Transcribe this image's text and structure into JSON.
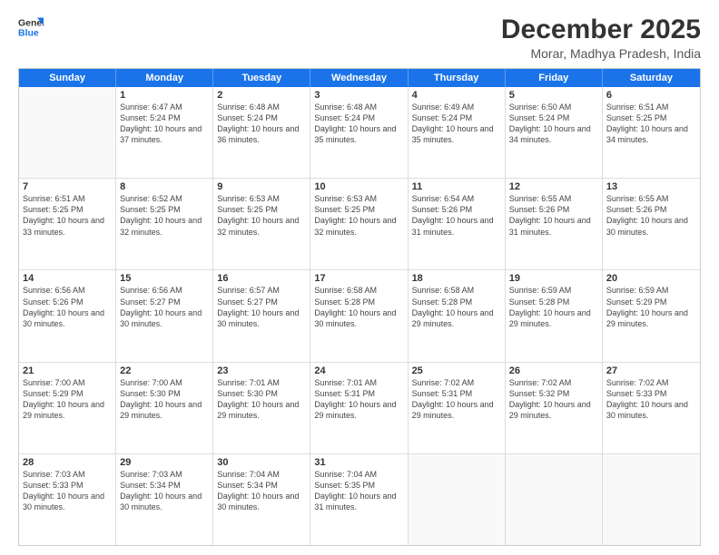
{
  "header": {
    "logo_line1": "General",
    "logo_line2": "Blue",
    "title": "December 2025",
    "subtitle": "Morar, Madhya Pradesh, India"
  },
  "weekdays": [
    "Sunday",
    "Monday",
    "Tuesday",
    "Wednesday",
    "Thursday",
    "Friday",
    "Saturday"
  ],
  "rows": [
    [
      {
        "day": "",
        "sunrise": "",
        "sunset": "",
        "daylight": ""
      },
      {
        "day": "1",
        "sunrise": "Sunrise: 6:47 AM",
        "sunset": "Sunset: 5:24 PM",
        "daylight": "Daylight: 10 hours and 37 minutes."
      },
      {
        "day": "2",
        "sunrise": "Sunrise: 6:48 AM",
        "sunset": "Sunset: 5:24 PM",
        "daylight": "Daylight: 10 hours and 36 minutes."
      },
      {
        "day": "3",
        "sunrise": "Sunrise: 6:48 AM",
        "sunset": "Sunset: 5:24 PM",
        "daylight": "Daylight: 10 hours and 35 minutes."
      },
      {
        "day": "4",
        "sunrise": "Sunrise: 6:49 AM",
        "sunset": "Sunset: 5:24 PM",
        "daylight": "Daylight: 10 hours and 35 minutes."
      },
      {
        "day": "5",
        "sunrise": "Sunrise: 6:50 AM",
        "sunset": "Sunset: 5:24 PM",
        "daylight": "Daylight: 10 hours and 34 minutes."
      },
      {
        "day": "6",
        "sunrise": "Sunrise: 6:51 AM",
        "sunset": "Sunset: 5:25 PM",
        "daylight": "Daylight: 10 hours and 34 minutes."
      }
    ],
    [
      {
        "day": "7",
        "sunrise": "Sunrise: 6:51 AM",
        "sunset": "Sunset: 5:25 PM",
        "daylight": "Daylight: 10 hours and 33 minutes."
      },
      {
        "day": "8",
        "sunrise": "Sunrise: 6:52 AM",
        "sunset": "Sunset: 5:25 PM",
        "daylight": "Daylight: 10 hours and 32 minutes."
      },
      {
        "day": "9",
        "sunrise": "Sunrise: 6:53 AM",
        "sunset": "Sunset: 5:25 PM",
        "daylight": "Daylight: 10 hours and 32 minutes."
      },
      {
        "day": "10",
        "sunrise": "Sunrise: 6:53 AM",
        "sunset": "Sunset: 5:25 PM",
        "daylight": "Daylight: 10 hours and 32 minutes."
      },
      {
        "day": "11",
        "sunrise": "Sunrise: 6:54 AM",
        "sunset": "Sunset: 5:26 PM",
        "daylight": "Daylight: 10 hours and 31 minutes."
      },
      {
        "day": "12",
        "sunrise": "Sunrise: 6:55 AM",
        "sunset": "Sunset: 5:26 PM",
        "daylight": "Daylight: 10 hours and 31 minutes."
      },
      {
        "day": "13",
        "sunrise": "Sunrise: 6:55 AM",
        "sunset": "Sunset: 5:26 PM",
        "daylight": "Daylight: 10 hours and 30 minutes."
      }
    ],
    [
      {
        "day": "14",
        "sunrise": "Sunrise: 6:56 AM",
        "sunset": "Sunset: 5:26 PM",
        "daylight": "Daylight: 10 hours and 30 minutes."
      },
      {
        "day": "15",
        "sunrise": "Sunrise: 6:56 AM",
        "sunset": "Sunset: 5:27 PM",
        "daylight": "Daylight: 10 hours and 30 minutes."
      },
      {
        "day": "16",
        "sunrise": "Sunrise: 6:57 AM",
        "sunset": "Sunset: 5:27 PM",
        "daylight": "Daylight: 10 hours and 30 minutes."
      },
      {
        "day": "17",
        "sunrise": "Sunrise: 6:58 AM",
        "sunset": "Sunset: 5:28 PM",
        "daylight": "Daylight: 10 hours and 30 minutes."
      },
      {
        "day": "18",
        "sunrise": "Sunrise: 6:58 AM",
        "sunset": "Sunset: 5:28 PM",
        "daylight": "Daylight: 10 hours and 29 minutes."
      },
      {
        "day": "19",
        "sunrise": "Sunrise: 6:59 AM",
        "sunset": "Sunset: 5:28 PM",
        "daylight": "Daylight: 10 hours and 29 minutes."
      },
      {
        "day": "20",
        "sunrise": "Sunrise: 6:59 AM",
        "sunset": "Sunset: 5:29 PM",
        "daylight": "Daylight: 10 hours and 29 minutes."
      }
    ],
    [
      {
        "day": "21",
        "sunrise": "Sunrise: 7:00 AM",
        "sunset": "Sunset: 5:29 PM",
        "daylight": "Daylight: 10 hours and 29 minutes."
      },
      {
        "day": "22",
        "sunrise": "Sunrise: 7:00 AM",
        "sunset": "Sunset: 5:30 PM",
        "daylight": "Daylight: 10 hours and 29 minutes."
      },
      {
        "day": "23",
        "sunrise": "Sunrise: 7:01 AM",
        "sunset": "Sunset: 5:30 PM",
        "daylight": "Daylight: 10 hours and 29 minutes."
      },
      {
        "day": "24",
        "sunrise": "Sunrise: 7:01 AM",
        "sunset": "Sunset: 5:31 PM",
        "daylight": "Daylight: 10 hours and 29 minutes."
      },
      {
        "day": "25",
        "sunrise": "Sunrise: 7:02 AM",
        "sunset": "Sunset: 5:31 PM",
        "daylight": "Daylight: 10 hours and 29 minutes."
      },
      {
        "day": "26",
        "sunrise": "Sunrise: 7:02 AM",
        "sunset": "Sunset: 5:32 PM",
        "daylight": "Daylight: 10 hours and 29 minutes."
      },
      {
        "day": "27",
        "sunrise": "Sunrise: 7:02 AM",
        "sunset": "Sunset: 5:33 PM",
        "daylight": "Daylight: 10 hours and 30 minutes."
      }
    ],
    [
      {
        "day": "28",
        "sunrise": "Sunrise: 7:03 AM",
        "sunset": "Sunset: 5:33 PM",
        "daylight": "Daylight: 10 hours and 30 minutes."
      },
      {
        "day": "29",
        "sunrise": "Sunrise: 7:03 AM",
        "sunset": "Sunset: 5:34 PM",
        "daylight": "Daylight: 10 hours and 30 minutes."
      },
      {
        "day": "30",
        "sunrise": "Sunrise: 7:04 AM",
        "sunset": "Sunset: 5:34 PM",
        "daylight": "Daylight: 10 hours and 30 minutes."
      },
      {
        "day": "31",
        "sunrise": "Sunrise: 7:04 AM",
        "sunset": "Sunset: 5:35 PM",
        "daylight": "Daylight: 10 hours and 31 minutes."
      },
      {
        "day": "",
        "sunrise": "",
        "sunset": "",
        "daylight": ""
      },
      {
        "day": "",
        "sunrise": "",
        "sunset": "",
        "daylight": ""
      },
      {
        "day": "",
        "sunrise": "",
        "sunset": "",
        "daylight": ""
      }
    ]
  ]
}
